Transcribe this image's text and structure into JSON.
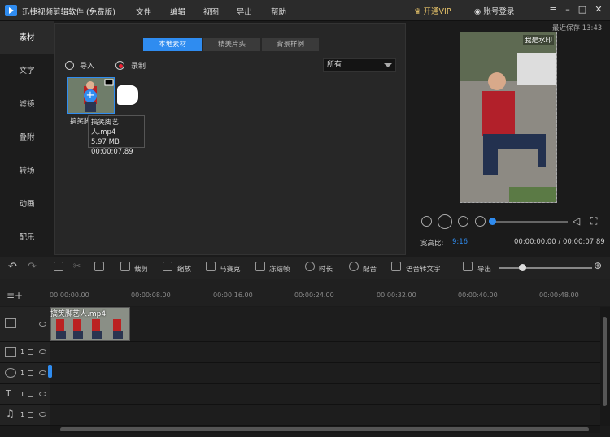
{
  "app": {
    "title": "迅捷视频剪辑软件 (免费版)",
    "save_time": "最近保存 13:43",
    "vip": "开通VIP",
    "login": "账号登录"
  },
  "menu": [
    "文件",
    "编辑",
    "视图",
    "导出",
    "帮助"
  ],
  "sidebar": {
    "items": [
      "素材",
      "文字",
      "滤镜",
      "叠附",
      "转场",
      "动画",
      "配乐"
    ]
  },
  "media": {
    "tabs": [
      "本地素材",
      "精美片头",
      "背景样例"
    ],
    "import": "导入",
    "record": "录制",
    "filter": "所有",
    "file": {
      "name": "搞笑脚艺人.mp4",
      "size": "5.97 MB",
      "duration": "00:00:07.89",
      "label": "搞笑脚"
    }
  },
  "preview": {
    "watermark": "我是水印",
    "ratio_label": "宽高比:",
    "ratio_value": "9:16",
    "timecode": "00:00:00.00 / 00:00:07.89",
    "progress": 0
  },
  "toolbar": [
    "裁剪",
    "缩放",
    "马赛克",
    "冻结帧",
    "时长",
    "配音",
    "语音转文字",
    "导出"
  ],
  "timeline": {
    "ticks": [
      "00:00:00.00",
      "00:00:08.00",
      "00:00:16.00",
      "00:00:24.00",
      "00:00:32.00",
      "00:00:40.00",
      "00:00:48.00"
    ],
    "clip_title": "搞笑脚艺人.mp4",
    "track_nums": [
      "1",
      "1",
      "1",
      "1"
    ]
  },
  "icons": {
    "logo": "video-logo-icon",
    "vip": "crown-icon",
    "user": "user-icon"
  },
  "colors": {
    "accent": "#2f8cf0",
    "vip": "#e8c46a"
  }
}
